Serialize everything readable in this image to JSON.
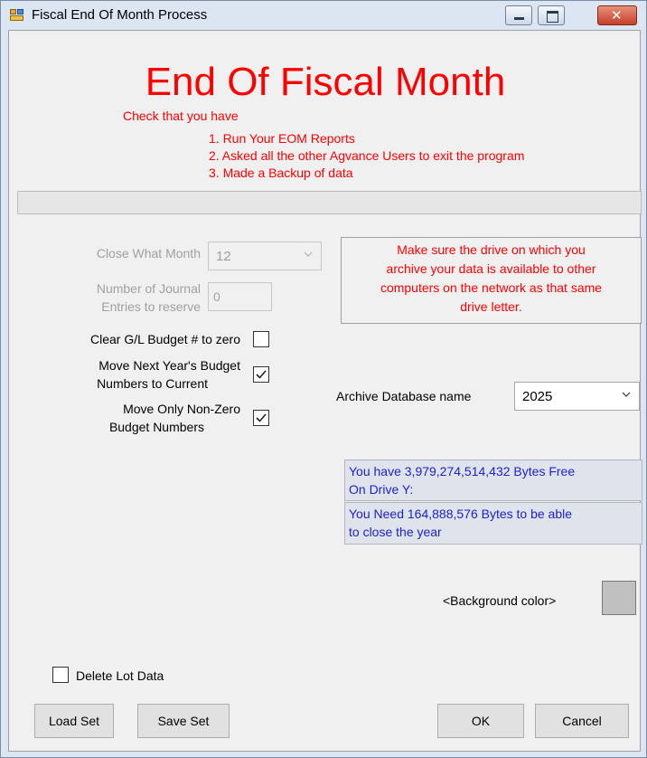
{
  "window": {
    "title": "Fiscal End Of Month Process"
  },
  "header": {
    "title": "End Of Fiscal Month",
    "intro": "Check that you have",
    "steps": [
      "1. Run Your EOM Reports",
      "2. Asked all the other Agvance Users to exit the program",
      "3. Made a Backup of data"
    ]
  },
  "fields": {
    "close_month_label": "Close What Month",
    "close_month_value": "12",
    "journal_label_1": "Number of Journal",
    "journal_label_2": "Entries to reserve",
    "journal_value": "0",
    "clear_budget_label": "Clear G/L Budget # to zero",
    "clear_budget_checked": false,
    "move_budget_label_1": "Move Next Year's Budget",
    "move_budget_label_2": "Numbers to Current",
    "move_budget_checked": true,
    "nonzero_label_1": "Move Only Non-Zero",
    "nonzero_label_2": "Budget Numbers",
    "nonzero_checked": true
  },
  "notice": {
    "line1": "Make sure the drive on which you",
    "line2": "archive your data is available to other",
    "line3": "computers on the network as that same",
    "line4": "drive letter."
  },
  "archive": {
    "label": "Archive Database name",
    "value": "2025"
  },
  "disk": {
    "free_line1": "You have 3,979,274,514,432 Bytes Free",
    "free_line2": "On Drive Y:",
    "need_line1": "You Need 164,888,576 Bytes to be able",
    "need_line2": "to close the year"
  },
  "background_color_label": "<Background color>",
  "delete_lot": {
    "label": "Delete Lot Data",
    "checked": false
  },
  "buttons": {
    "load_set": "Load Set",
    "save_set": "Save Set",
    "ok": "OK",
    "cancel": "Cancel"
  },
  "colors": {
    "accent_red": "#ff0000",
    "info_blue": "#2020d0",
    "swatch": "#c0c0c0"
  }
}
